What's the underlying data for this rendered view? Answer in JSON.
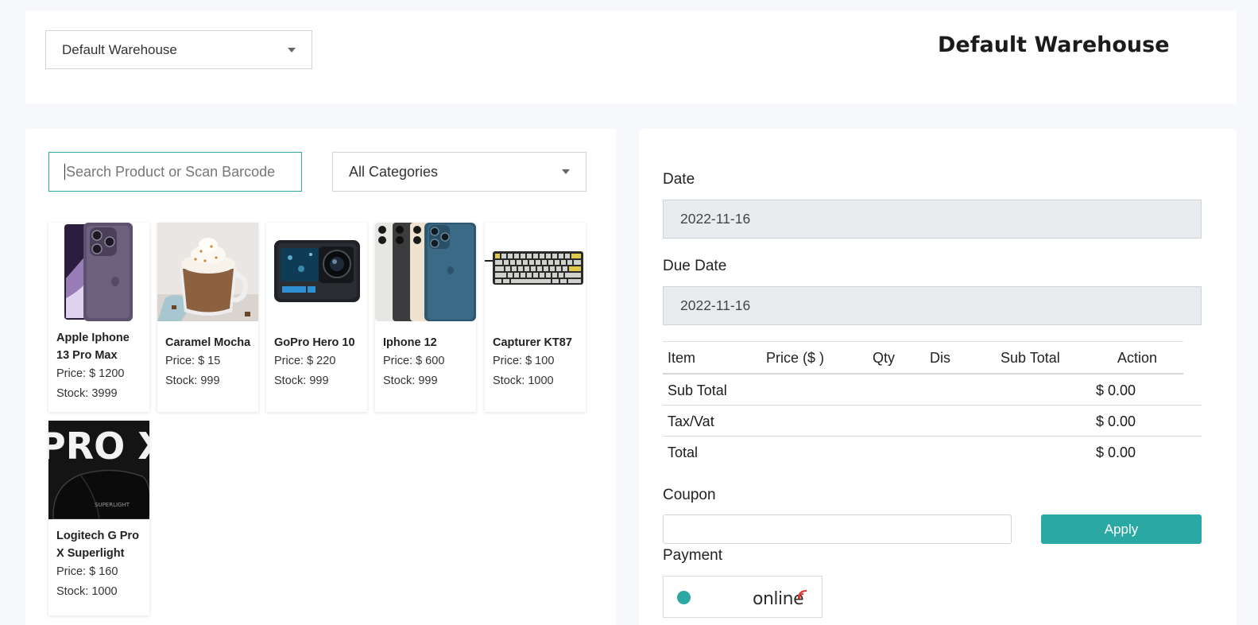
{
  "warehouse": {
    "selected": "Default Warehouse",
    "title": "Default Warehouse"
  },
  "products_panel": {
    "search_placeholder": "Search Product or Scan Barcode",
    "category_selected": "All Categories",
    "items": [
      {
        "name": "Apple Iphone 13 Pro Max",
        "price": "Price: $ 1200",
        "stock": "Stock: 3999",
        "icon": "iphone-purple-image"
      },
      {
        "name": "Caramel Mocha",
        "price": "Price: $ 15",
        "stock": "Stock: 999",
        "icon": "coffee-mug-image"
      },
      {
        "name": "GoPro Hero 10",
        "price": "Price: $ 220",
        "stock": "Stock: 999",
        "icon": "action-camera-image"
      },
      {
        "name": "Iphone 12",
        "price": "Price: $ 600",
        "stock": "Stock: 999",
        "icon": "iphone-colors-image"
      },
      {
        "name": "Capturer KT87",
        "price": "Price: $ 100",
        "stock": "Stock: 1000",
        "icon": "keyboard-image"
      },
      {
        "name": "Logitech G Pro X Superlight",
        "price": "Price: $ 160",
        "stock": "Stock: 1000",
        "icon": "mouse-image",
        "image_text": "PRO X",
        "image_subtext": "SUPERLIGHT"
      }
    ]
  },
  "order_panel": {
    "date_label": "Date",
    "date_value": "2022-11-16",
    "due_date_label": "Due Date",
    "due_date_value": "2022-11-16",
    "table_headers": [
      "Item",
      "Price ($ )",
      "Qty",
      "Dis",
      "Sub Total",
      "Action"
    ],
    "summary": [
      {
        "label": "Sub Total",
        "value": "$ 0.00"
      },
      {
        "label": "Tax/Vat",
        "value": "$ 0.00"
      },
      {
        "label": "Total",
        "value": "$ 0.00"
      }
    ],
    "coupon_label": "Coupon",
    "coupon_value": "",
    "apply_label": "Apply",
    "payment_label": "Payment",
    "payment_option": "online"
  },
  "colors": {
    "accent": "#2aa8a3",
    "page_bg": "#f7f8fb",
    "readonly_field": "#e9ecef"
  }
}
